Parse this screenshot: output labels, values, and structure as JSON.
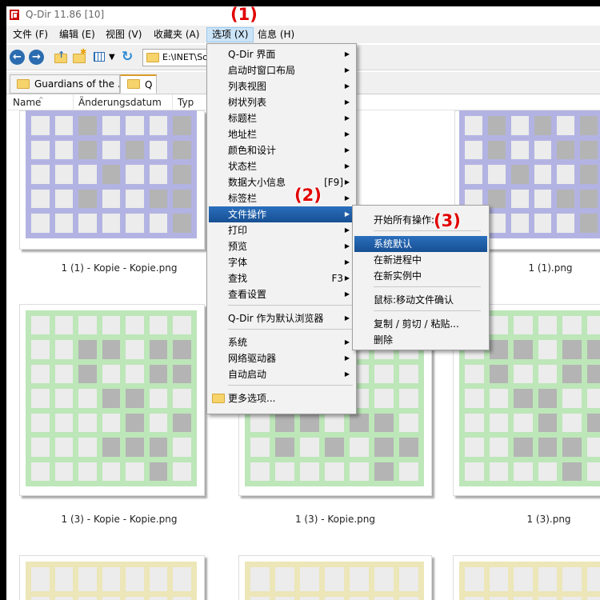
{
  "window": {
    "title": "Q-Dir 11.86 [10]"
  },
  "menubar": [
    {
      "label": "文件 (F)"
    },
    {
      "label": "编辑 (E)"
    },
    {
      "label": "视图 (V)"
    },
    {
      "label": "收藏夹 (A)"
    },
    {
      "label": "选项 (X)"
    },
    {
      "label": "信息 (H)"
    }
  ],
  "toolbar": {
    "path": "E:\\INET\\So"
  },
  "tabs": [
    {
      "label": "Guardians of the ..."
    },
    {
      "label": "Q"
    }
  ],
  "columns": [
    "Name",
    "Änderungsdatum",
    "Typ"
  ],
  "thumbnails": [
    {
      "caption": "1 (1) - Kopie - Kopie.png",
      "color": "#b3b3e3"
    },
    {
      "caption": "1 (1).png",
      "color": "#b3b3e3"
    },
    {
      "caption": "1 (3) - Kopie - Kopie.png",
      "color": "#bde6b9"
    },
    {
      "caption": "1 (3) - Kopie.png",
      "color": "#bde6b9"
    },
    {
      "caption": "1 (3).png",
      "color": "#bde6b9"
    },
    {
      "caption": "",
      "color": "#ece6b8"
    }
  ],
  "options_menu": [
    {
      "label": "Q-Dir 界面",
      "arrow": true
    },
    {
      "label": "启动时窗口布局",
      "arrow": true
    },
    {
      "label": "列表视图",
      "arrow": true
    },
    {
      "label": "树状列表",
      "arrow": true
    },
    {
      "label": "标题栏",
      "arrow": true
    },
    {
      "label": "地址栏",
      "arrow": true
    },
    {
      "label": "颜色和设计",
      "arrow": true
    },
    {
      "label": "状态栏",
      "arrow": true
    },
    {
      "label": "数据大小信息",
      "shortcut": "[F9]",
      "arrow": true
    },
    {
      "label": "标签栏",
      "arrow": true
    },
    {
      "label": "文件操作",
      "arrow": true,
      "highlight": true
    },
    {
      "label": "打印",
      "arrow": true
    },
    {
      "label": "预览",
      "arrow": true
    },
    {
      "label": "字体",
      "arrow": true
    },
    {
      "label": "查找",
      "shortcut": "F3",
      "arrow": true
    },
    {
      "label": "查看设置",
      "arrow": true
    },
    {
      "label": "Q-Dir 作为默认浏览器",
      "arrow": true
    },
    {
      "label": "系统",
      "arrow": true
    },
    {
      "label": "网络驱动器",
      "arrow": true
    },
    {
      "label": "自动启动",
      "arrow": true
    },
    {
      "label": "更多选项..."
    }
  ],
  "file_ops_menu": [
    {
      "label": "开始所有操作:"
    },
    {
      "label": "系统默认",
      "highlight": true
    },
    {
      "label": "在新进程中"
    },
    {
      "label": "在新实例中"
    },
    {
      "label": "鼠标:移动文件确认"
    },
    {
      "label": "复制 / 剪切 / 粘贴..."
    },
    {
      "label": "删除"
    }
  ],
  "markers": [
    "(1)",
    "(2)",
    "(3)"
  ],
  "colors": {
    "highlight": "#1f5fa8",
    "marker": "#e00000"
  }
}
